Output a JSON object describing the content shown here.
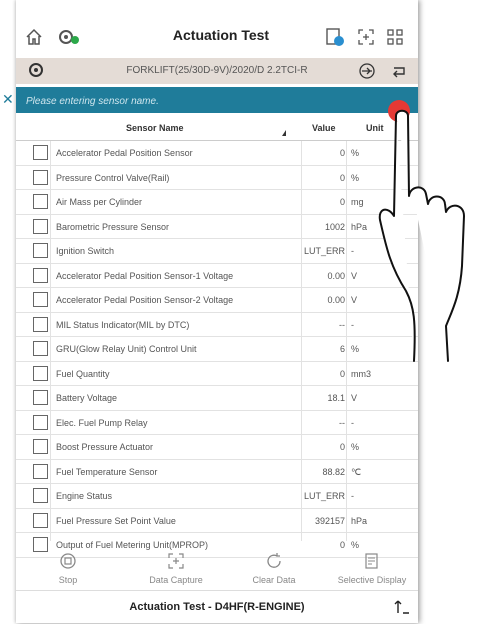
{
  "header": {
    "title": "Actuation Test",
    "vehicle": "FORKLIFT(25/30D-9V)/2020/D 2.2TCI-R"
  },
  "search": {
    "placeholder": "Please entering sensor name."
  },
  "table": {
    "columns": {
      "name": "Sensor Name",
      "value": "Value",
      "unit": "Unit"
    },
    "rows": [
      {
        "name": "Accelerator Pedal Position Sensor",
        "value": "0",
        "unit": "%"
      },
      {
        "name": "Pressure Control Valve(Rail)",
        "value": "0",
        "unit": "%"
      },
      {
        "name": "Air Mass per Cylinder",
        "value": "0",
        "unit": "mg"
      },
      {
        "name": "Barometric Pressure Sensor",
        "value": "1002",
        "unit": "hPa"
      },
      {
        "name": "Ignition Switch",
        "value": "LUT_ERR",
        "unit": "-"
      },
      {
        "name": "Accelerator Pedal Position Sensor-1 Voltage",
        "value": "0.00",
        "unit": "V"
      },
      {
        "name": "Accelerator Pedal Position Sensor-2 Voltage",
        "value": "0.00",
        "unit": "V"
      },
      {
        "name": "MIL Status Indicator(MIL by DTC)",
        "value": "--",
        "unit": "-"
      },
      {
        "name": "GRU(Glow Relay Unit) Control Unit",
        "value": "6",
        "unit": "%"
      },
      {
        "name": "Fuel Quantity",
        "value": "0",
        "unit": "mm3"
      },
      {
        "name": "Battery Voltage",
        "value": "18.1",
        "unit": "V"
      },
      {
        "name": "Elec. Fuel Pump Relay",
        "value": "--",
        "unit": "-"
      },
      {
        "name": "Boost Pressure Actuator",
        "value": "0",
        "unit": "%"
      },
      {
        "name": "Fuel Temperature Sensor",
        "value": "88.82",
        "unit": "℃"
      },
      {
        "name": "Engine Status",
        "value": "LUT_ERR",
        "unit": "-"
      },
      {
        "name": "Fuel Pressure Set Point Value",
        "value": "392157",
        "unit": "hPa"
      },
      {
        "name": "Output of Fuel Metering Unit(MPROP)",
        "value": "0",
        "unit": "%"
      }
    ]
  },
  "bottom_bar": {
    "stop": "Stop",
    "data_capture": "Data Capture",
    "clear_data": "Clear Data",
    "selective_display": "Selective Display"
  },
  "footer": {
    "title": "Actuation Test  -  D4HF(R-ENGINE)"
  },
  "colors": {
    "search_bar": "#1f7c9a",
    "vehicle_bar": "#e4dcd6",
    "touch_dot": "#e53935"
  },
  "icons": [
    "home-icon",
    "vci-icon",
    "report-icon",
    "capture-icon",
    "grid-icon",
    "vci-small-icon",
    "battery-plug-icon",
    "return-icon",
    "stop-icon",
    "data-capture-icon",
    "clear-data-icon",
    "selective-display-icon",
    "exit-icon",
    "hand-pointer-icon"
  ]
}
